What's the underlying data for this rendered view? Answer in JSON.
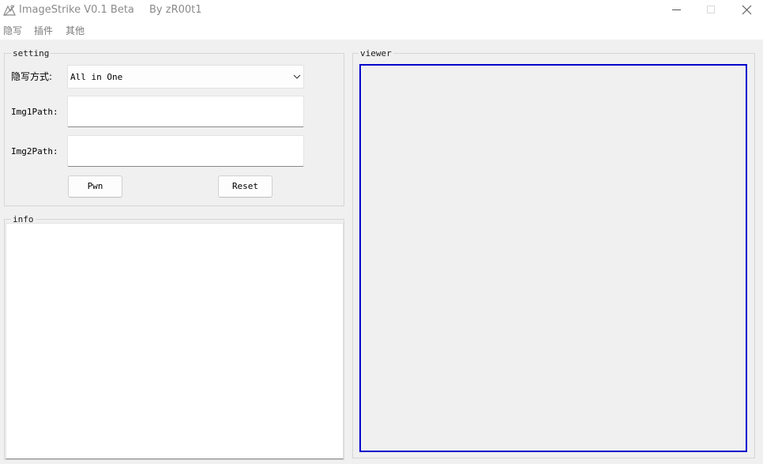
{
  "window": {
    "title": "ImageStrike  V0.1 Beta",
    "author": "By zR00t1",
    "app_icon": "image-strike-app-icon",
    "controls": {
      "minimize_icon": "minimize-icon",
      "maximize_icon": "maximize-icon",
      "close_icon": "close-icon"
    }
  },
  "menubar": {
    "items": [
      {
        "label": "隐写"
      },
      {
        "label": "插件"
      },
      {
        "label": "其他"
      }
    ]
  },
  "setting": {
    "title": "setting",
    "method_label": "隐写方式:",
    "method_value": "All in One",
    "method_dropdown_icon": "chevron-down-icon",
    "img1_label": "Img1Path:",
    "img1_value": "",
    "img2_label": "Img2Path:",
    "img2_value": "",
    "pwn_label": "Pwn",
    "reset_label": "Reset"
  },
  "info": {
    "title": "info",
    "content": ""
  },
  "viewer": {
    "title": "viewer",
    "border_color": "#0000cc"
  },
  "colors": {
    "background": "#f0f0f0",
    "titlebar": "#ffffff",
    "title_text": "#8a8a8a",
    "viewer_border": "#0000cc"
  }
}
